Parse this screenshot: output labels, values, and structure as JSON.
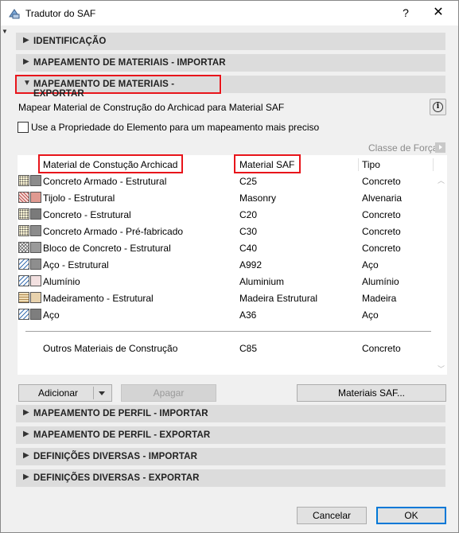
{
  "window": {
    "title": "Tradutor do SAF"
  },
  "sections_top": [
    {
      "label": "IDENTIFICAÇÃO",
      "expanded": false
    },
    {
      "label": "MAPEAMENTO DE MATERIAIS - IMPORTAR",
      "expanded": false
    },
    {
      "label": "MAPEAMENTO DE MATERIAIS - EXPORTAR",
      "expanded": true
    }
  ],
  "mapping": {
    "description": "Mapear Material de Construção do Archicad para Material SAF",
    "checkbox_label": "Use a Propriedade do Elemento para um mapeamento mais preciso",
    "checkbox_checked": false,
    "force_class_label": "Classe de Força",
    "columns": {
      "archicad": "Material de Constução Archicad",
      "saf": "Material SAF",
      "type": "Tipo"
    },
    "rows": [
      {
        "archicad": "Concreto Armado - Estrutural",
        "saf": "C25",
        "type": "Concreto",
        "hatch": "dots",
        "color": "#8c8c8c"
      },
      {
        "archicad": "Tijolo - Estrutural",
        "saf": "Masonry",
        "type": "Alvenaria",
        "hatch": "brick",
        "color": "#e09a91"
      },
      {
        "archicad": "Concreto - Estrutural",
        "saf": "C20",
        "type": "Concreto",
        "hatch": "dots",
        "color": "#7a7a7a"
      },
      {
        "archicad": "Concreto Armado - Pré-fabricado",
        "saf": "C30",
        "type": "Concreto",
        "hatch": "dots",
        "color": "#8c8c8c"
      },
      {
        "archicad": "Bloco de Concreto - Estrutural",
        "saf": "C40",
        "type": "Concreto",
        "hatch": "cross",
        "color": "#9a9a9a"
      },
      {
        "archicad": "Aço - Estrutural",
        "saf": "A992",
        "type": "Aço",
        "hatch": "diag",
        "color": "#8e8e8e"
      },
      {
        "archicad": "Alumínio",
        "saf": "Aluminium",
        "type": "Alumínio",
        "hatch": "diag",
        "color": "#f2e0e0"
      },
      {
        "archicad": "Madeiramento - Estrutural",
        "saf": "Madeira Estrutural",
        "type": "Madeira",
        "hatch": "wood",
        "color": "#e8d2ad"
      },
      {
        "archicad": "Aço",
        "saf": "A36",
        "type": "Aço",
        "hatch": "diag",
        "color": "#7e7e7e"
      }
    ],
    "other": {
      "archicad": "Outros Materiais de Construção",
      "saf": "C85",
      "type": "Concreto"
    },
    "buttons": {
      "add": "Adicionar",
      "delete": "Apagar",
      "saf_materials": "Materiais SAF..."
    }
  },
  "sections_bottom": [
    {
      "label": "MAPEAMENTO DE PERFIL - IMPORTAR",
      "expanded": false
    },
    {
      "label": "MAPEAMENTO DE PERFIL - EXPORTAR",
      "expanded": false
    },
    {
      "label": "DEFINIÇÕES DIVERSAS - IMPORTAR",
      "expanded": false
    },
    {
      "label": "DEFINIÇÕES DIVERSAS - EXPORTAR",
      "expanded": false
    }
  ],
  "footer": {
    "cancel": "Cancelar",
    "ok": "OK"
  },
  "colors": {
    "highlight": "#e8151b",
    "section_bg": "#dcdcdc",
    "dialog_bg": "#f0f0f0"
  }
}
